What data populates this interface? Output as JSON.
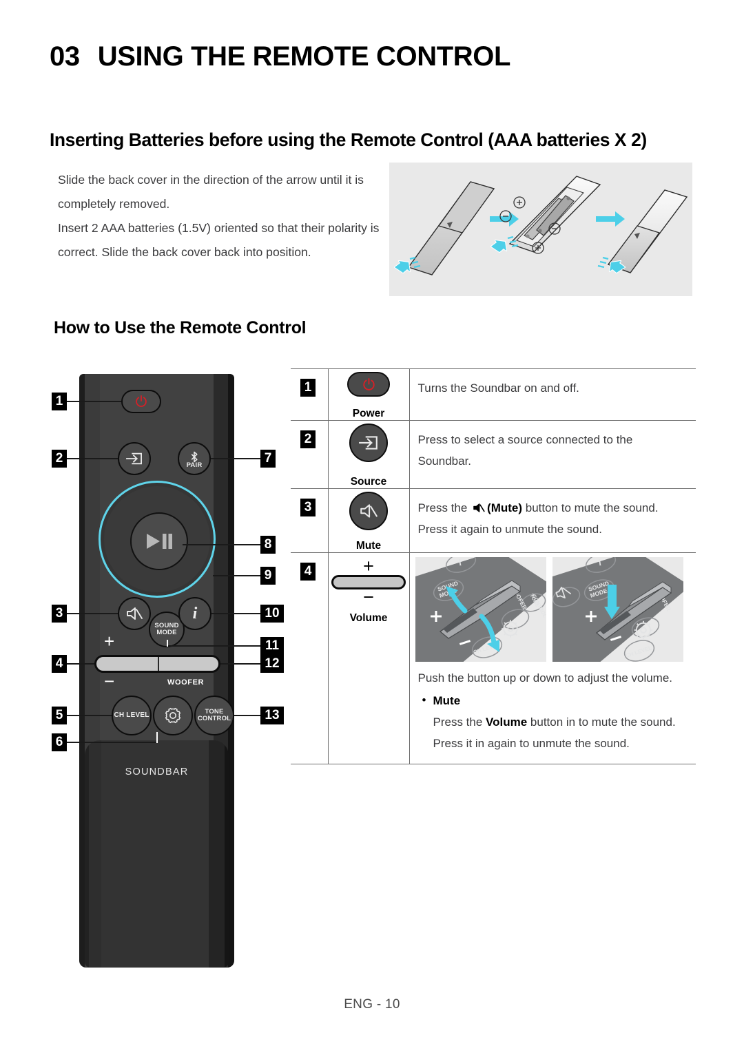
{
  "chapter": {
    "number": "03",
    "title": "USING THE REMOTE CONTROL"
  },
  "sections": {
    "batteries_heading": "Inserting Batteries before using the Remote Control (AAA batteries X 2)",
    "batteries_text": "Slide the back cover in the direction of the arrow until it is completely removed.\nInsert 2 AAA batteries (1.5V) oriented so that their polarity is correct. Slide the back cover back into position.",
    "batteries_text_line1": "Slide the back cover in the direction of the arrow until it is completely removed.",
    "batteries_text_line2": "Insert 2 AAA batteries (1.5V) oriented so that their polarity is correct. Slide the back cover back into position.",
    "howto_heading": "How to Use the Remote Control"
  },
  "battery_figure": {
    "polarity_marks": [
      "+",
      "−",
      "−",
      "+"
    ],
    "steps": 3,
    "background": "#e9e9e9",
    "arrow_color": "#4ccfe8"
  },
  "remote": {
    "brand_label": "SOUNDBAR",
    "buttons": {
      "power": "power-icon",
      "source": "source-icon",
      "pair": "PAIR",
      "play_pause": "play-pause-icon",
      "mute": "mute-icon",
      "sound_mode": "SOUND\nMODE",
      "sound_mode_line1": "SOUND",
      "sound_mode_line2": "MODE",
      "info": "i",
      "ch_level": "CH LEVEL",
      "settings": "gear-icon",
      "tone_control_line1": "TONE",
      "tone_control_line2": "CONTROL",
      "woofer": "WOOFER",
      "volume_plus": "+",
      "volume_minus": "−"
    },
    "callouts_left": [
      "1",
      "2",
      "3",
      "4",
      "5",
      "6"
    ],
    "callouts_right": [
      "7",
      "8",
      "9",
      "10",
      "11",
      "12",
      "13"
    ],
    "accent_ring_color": "#5fd4ea",
    "power_icon_color": "#d81f26"
  },
  "table": {
    "rows": [
      {
        "num": "1",
        "key": "Power",
        "icon": "power-icon",
        "desc": "Turns the Soundbar on and off."
      },
      {
        "num": "2",
        "key": "Source",
        "icon": "source-icon",
        "desc": "Press to select a source connected to the Soundbar."
      },
      {
        "num": "3",
        "key": "Mute",
        "icon": "mute-icon",
        "desc_a": "Press the ",
        "desc_b": "(Mute)",
        "desc_c": " button to mute the sound. Press it again to unmute the sound."
      },
      {
        "num": "4",
        "key": "Volume",
        "icon": "volume-rocker",
        "desc_main": "Push the button up or down to adjust the volume.",
        "bullet_title": "Mute",
        "bullet_a": "Press the ",
        "bullet_b": "Volume",
        "bullet_c": " button in to mute the sound. Press it in again to unmute the sound."
      }
    ]
  },
  "footer": {
    "page_label": "ENG - 10"
  }
}
